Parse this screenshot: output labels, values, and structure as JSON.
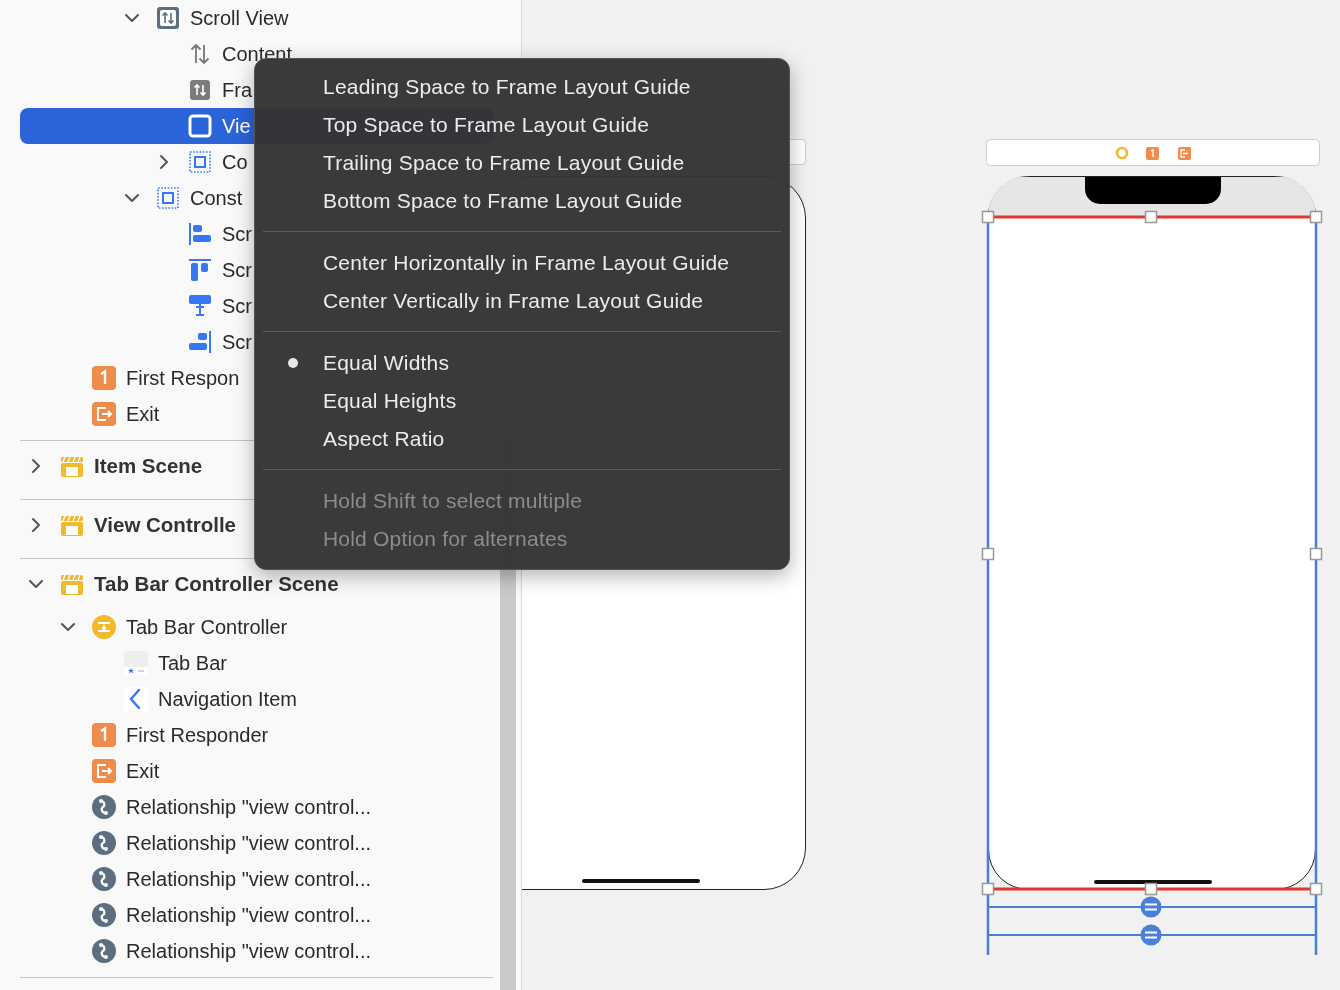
{
  "outline": {
    "partial_scene": {
      "nested_items": [
        {
          "label": "Scroll View",
          "kind": "scroll-view",
          "expanded": true,
          "selected": false,
          "children": [
            {
              "label": "Content",
              "kind": "content-layout",
              "selected": false
            },
            {
              "label": "Fra",
              "kind": "frame-layout",
              "selected": false
            },
            {
              "label": "Vie",
              "kind": "view",
              "selected": true
            },
            {
              "label": "Co",
              "kind": "constraints",
              "expanded": false,
              "selected": false
            }
          ]
        },
        {
          "label": "Const",
          "kind": "constraints",
          "expanded": true,
          "selected": false,
          "children": [
            {
              "label": "Scr",
              "kind": "leading",
              "selected": false
            },
            {
              "label": "Scr",
              "kind": "top",
              "selected": false
            },
            {
              "label": "Scr",
              "kind": "bottom",
              "selected": false
            },
            {
              "label": "Scr",
              "kind": "trailing",
              "selected": false
            }
          ]
        }
      ],
      "items": [
        {
          "label": "First Respon",
          "kind": "first-responder",
          "selected": false
        },
        {
          "label": "Exit",
          "kind": "exit",
          "selected": false
        }
      ]
    },
    "scenes": [
      {
        "title": "Item Scene",
        "expanded": false
      },
      {
        "title": "View Controlle",
        "expanded": false
      },
      {
        "title": "Tab Bar Controller Scene",
        "expanded": true,
        "items": [
          {
            "label": "Tab Bar Controller",
            "kind": "tab-bar-controller",
            "expanded": true,
            "selected": false,
            "children": [
              {
                "label": "Tab Bar",
                "kind": "tab-bar",
                "selected": false
              },
              {
                "label": "Navigation Item",
                "kind": "nav-item",
                "selected": false
              }
            ]
          },
          {
            "label": "First Responder",
            "kind": "first-responder",
            "selected": false
          },
          {
            "label": "Exit",
            "kind": "exit",
            "selected": false
          },
          {
            "label": "Relationship \"view control...",
            "kind": "relationship",
            "selected": false
          },
          {
            "label": "Relationship \"view control...",
            "kind": "relationship",
            "selected": false
          },
          {
            "label": "Relationship \"view control...",
            "kind": "relationship",
            "selected": false
          },
          {
            "label": "Relationship \"view control...",
            "kind": "relationship",
            "selected": false
          },
          {
            "label": "Relationship \"view control...",
            "kind": "relationship",
            "selected": false
          }
        ]
      }
    ]
  },
  "context_menu": {
    "groups": [
      {
        "items": [
          {
            "label": "Leading Space to Frame Layout Guide",
            "checked": false
          },
          {
            "label": "Top Space to Frame Layout Guide",
            "checked": false
          },
          {
            "label": "Trailing Space to Frame Layout Guide",
            "checked": false
          },
          {
            "label": "Bottom Space to Frame Layout Guide",
            "checked": false
          }
        ]
      },
      {
        "items": [
          {
            "label": "Center Horizontally in Frame Layout Guide",
            "checked": false
          },
          {
            "label": "Center Vertically in Frame Layout Guide",
            "checked": false
          }
        ]
      },
      {
        "items": [
          {
            "label": "Equal Widths",
            "checked": true
          },
          {
            "label": "Equal Heights",
            "checked": false
          },
          {
            "label": "Aspect Ratio",
            "checked": false
          }
        ]
      }
    ],
    "hints": [
      "Hold Shift to select multiple",
      "Hold Option for alternates"
    ]
  }
}
